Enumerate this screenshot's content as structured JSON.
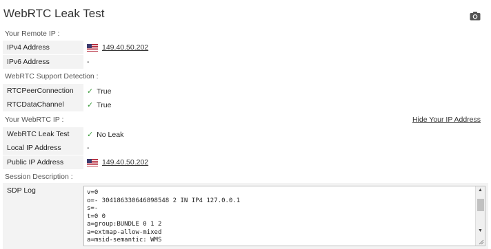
{
  "title": "WebRTC Leak Test",
  "icons": {
    "camera": "camera-icon",
    "flag": "us-flag-icon",
    "check": "checkmark-icon"
  },
  "colors": {
    "check": "#3a9a3a",
    "row_bg": "#f3f3f3"
  },
  "remote_ip": {
    "section_label": "Your Remote IP :",
    "ipv4_label": "IPv4 Address",
    "ipv4_value": "149.40.50.202",
    "ipv6_label": "IPv6 Address",
    "ipv6_value": "-"
  },
  "support": {
    "section_label": "WebRTC Support Detection :",
    "peer_label": "RTCPeerConnection",
    "peer_value": "True",
    "channel_label": "RTCDataChannel",
    "channel_value": "True"
  },
  "webrtc_ip": {
    "section_label": "Your WebRTC IP :",
    "hide_link": "Hide Your IP Address",
    "leak_label": "WebRTC Leak Test",
    "leak_value": "No Leak",
    "local_label": "Local IP Address",
    "local_value": "-",
    "public_label": "Public IP Address",
    "public_value": "149.40.50.202"
  },
  "session": {
    "section_label": "Session Description :",
    "sdp_label": "SDP Log",
    "sdp_lines": [
      "v=0",
      "o=- 304186330646898548 2 IN IP4 127.0.0.1",
      "s=-",
      "t=0 0",
      "a=group:BUNDLE 0 1 2",
      "a=extmap-allow-mixed",
      "a=msid-semantic: WMS"
    ]
  }
}
